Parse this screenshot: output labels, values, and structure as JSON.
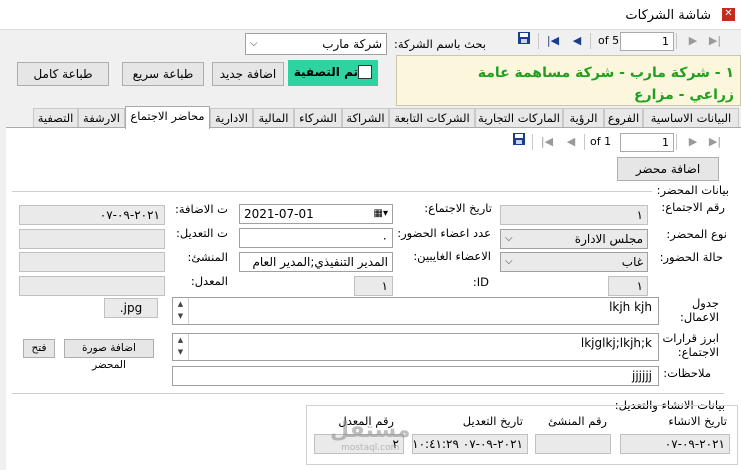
{
  "window": {
    "title": "شاشة الشركات"
  },
  "top_pager": {
    "current": "1",
    "of_label": "of 5"
  },
  "search": {
    "label": "بحث باسم الشركة:",
    "value": "شركة مارب"
  },
  "company_card": {
    "line1": "١ - شركة مارب - شركة مساهمة عامة",
    "line2": "زراعي - مزارع"
  },
  "toolbar": {
    "filter_label": "تم التصفية",
    "add_new": "اضافة جديد",
    "quick_print": "طباعة سريع",
    "full_print": "طباعة كامل"
  },
  "tabs": [
    "البيانات الاساسية",
    "الفروع",
    "الرؤية",
    "الماركات التجارية",
    "الشركات التابعة",
    "الشراكة",
    "الشركاء",
    "المالية",
    "الادارية",
    "محاضر الاجتماع",
    "الارشفة",
    "التصفية"
  ],
  "active_tab": "محاضر الاجتماع",
  "inner_pager": {
    "current": "1",
    "of_label": "of 1"
  },
  "minutes": {
    "add_button": "اضافة محضر",
    "section_title": "بيانات المحضر:",
    "meeting_number_label": "رقم الاجتماع:",
    "meeting_number": "١",
    "minute_type_label": "نوع المحضر:",
    "minute_type": "مجلس الادارة",
    "attendance_status_label": "حالة الحضور:",
    "attendance_status": "غاب",
    "id_label": "ID:",
    "id_value": "١",
    "meeting_date_label": "تاريخ الاجتماع:",
    "meeting_date": "2021-07-01",
    "attendees_count_label": "عدد اعضاء الحضور:",
    "attendees_count": "٠",
    "absent_members_label": "الاعضاء الغايبين:",
    "absent_members": "المدير التنفيذي;المدير العام",
    "added_date_label": "ت الاضافة:",
    "added_date": "٢٠٢١-٠٩-٠٧",
    "edited_date_label": "ت التعديل:",
    "creator_label": "المنشئ:",
    "modifier_label": "المعدل:",
    "agenda_label": "جدول الاعمال:",
    "agenda": "lkjh kjh",
    "decisions_label": "ابرز قرارات الاجتماع:",
    "decisions": "lkjglkj;lkjh;k",
    "notes_label": "ملاحظات:",
    "notes": "jjjjjj",
    "file_ext": "jpg.",
    "add_image_button": "اضافة صورة المحضر",
    "open_button": "فتح"
  },
  "audit": {
    "section_title": "بيانات الانشاء والتعديل:",
    "created_date_label": "تاريخ الانشاء",
    "created_date": "٢٠٢١-٠٩-٠٧",
    "creator_number_label": "رقم المنشئ",
    "edited_date_label": "تاريخ التعديل",
    "edited_date": "٢٠٢١-٠٩-٠٧ ١٠:٤١:٢٩ م",
    "modifier_number_label": "رقم المعدل",
    "modifier_number": "٢"
  },
  "watermark": {
    "brand": "مستقل",
    "domain": "mostaql.com"
  }
}
